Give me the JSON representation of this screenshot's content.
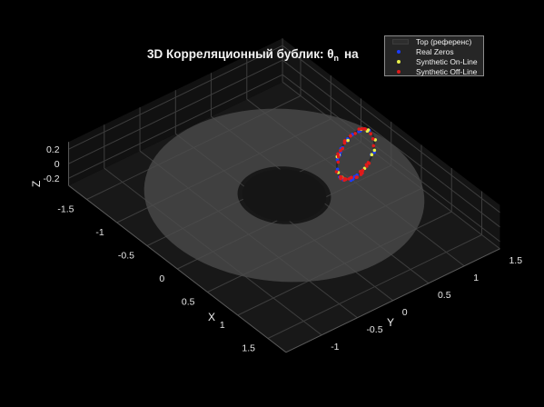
{
  "chart_data": {
    "type": "3d-torus-scatter",
    "title": "3D Корреляционный бублик: θ",
    "title_subscript": "n",
    "title_suffix": "на",
    "xlabel": "X",
    "ylabel": "Y",
    "zlabel": "Z",
    "xlim": [
      -1.8,
      1.8
    ],
    "ylim": [
      -1.5,
      1.5
    ],
    "zlim": [
      -0.3,
      0.3
    ],
    "x_ticks": [
      "-1.5",
      "-1",
      "-0.5",
      "0",
      "0.5",
      "1",
      "1.5"
    ],
    "x_tick_values": [
      -1.5,
      -1,
      -0.5,
      0,
      0.5,
      1,
      1.5
    ],
    "y_ticks": [
      "-1",
      "-0.5",
      "0",
      "0.5",
      "1",
      "1.5"
    ],
    "y_tick_values": [
      -1,
      -0.5,
      0,
      0.5,
      1,
      1.5
    ],
    "z_ticks": [
      "0.2",
      "0",
      "-0.2"
    ],
    "z_tick_values": [
      0.2,
      0,
      -0.2
    ],
    "grid": true,
    "background": "#000000",
    "legend_position": "top-right",
    "torus": {
      "major_radius": 1.0,
      "minor_radius": 0.5,
      "color": "#4d4d4d"
    },
    "zeros_loop": {
      "center_x": 0,
      "center_y": 1.0,
      "radius": 0.4
    },
    "series": [
      {
        "name": "Top (референс)",
        "marker": "surface",
        "color": "#333333"
      },
      {
        "name": "Real Zeros",
        "marker": "dot",
        "color": "#1a3cff",
        "count": 28
      },
      {
        "name": "Synthetic On-Line",
        "marker": "dot",
        "color": "#e8f04a",
        "count": 14
      },
      {
        "name": "Synthetic Off-Line",
        "marker": "dot",
        "color": "#e01a1a",
        "count": 40
      }
    ]
  }
}
